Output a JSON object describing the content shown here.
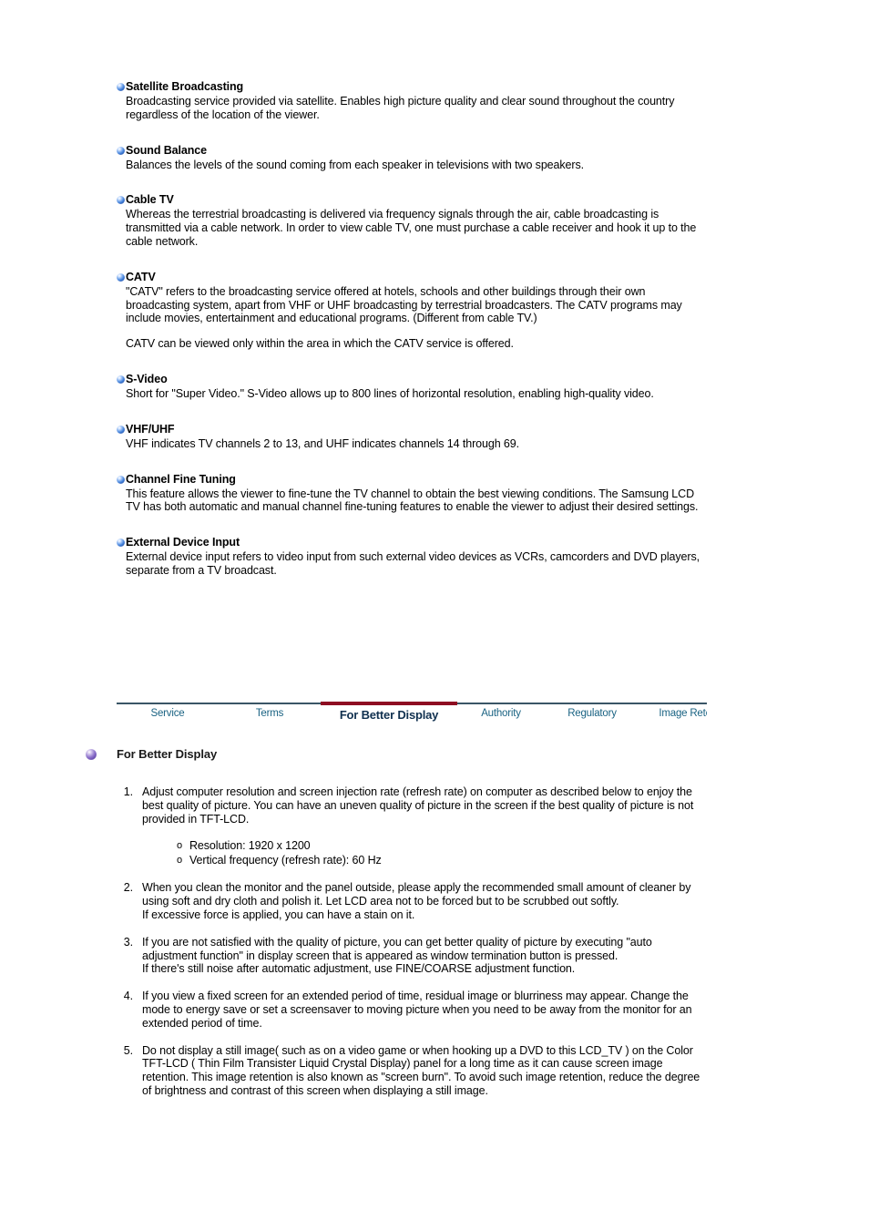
{
  "glossary": {
    "terms": [
      {
        "title": "Satellite Broadcasting",
        "paragraphs": [
          "Broadcasting service provided via satellite. Enables high picture quality and clear sound throughout the country regardless of the location of the viewer."
        ]
      },
      {
        "title": "Sound Balance",
        "paragraphs": [
          "Balances the levels of the sound coming from each speaker in televisions with two speakers."
        ]
      },
      {
        "title": "Cable TV",
        "paragraphs": [
          "Whereas the terrestrial broadcasting is delivered via frequency signals through the air, cable broadcasting is transmitted via a cable network. In order to view cable TV, one must purchase a cable receiver and hook it up to the cable network."
        ]
      },
      {
        "title": "CATV",
        "paragraphs": [
          "\"CATV\" refers to the broadcasting service offered at hotels, schools and other buildings through their own broadcasting system, apart from VHF or UHF broadcasting by terrestrial broadcasters. The CATV programs may include movies, entertainment and educational programs. (Different from cable TV.)",
          "CATV can be viewed only within the area in which the CATV service is offered."
        ]
      },
      {
        "title": "S-Video",
        "paragraphs": [
          "Short for \"Super Video.\" S-Video allows up to 800 lines of horizontal resolution, enabling high-quality video."
        ]
      },
      {
        "title": "VHF/UHF",
        "paragraphs": [
          "VHF indicates TV channels 2 to 13, and UHF indicates channels 14 through 69."
        ]
      },
      {
        "title": "Channel Fine Tuning",
        "paragraphs": [
          "This feature allows the viewer to fine-tune the TV channel to obtain the best viewing conditions. The Samsung LCD TV has both automatic and manual channel fine-tuning features to enable the viewer to adjust their desired settings."
        ]
      },
      {
        "title": "External Device Input",
        "paragraphs": [
          "External device input refers to video input from such external video devices as VCRs, camcorders and DVD players, separate from a TV broadcast."
        ]
      }
    ]
  },
  "tabnav": {
    "tabs": [
      {
        "label": "Service",
        "active": false
      },
      {
        "label": "Terms",
        "active": false
      },
      {
        "label": "For Better Display",
        "active": true
      },
      {
        "label": "Authority",
        "active": false
      },
      {
        "label": "Regulatory",
        "active": false
      },
      {
        "label": "Image Retention Free",
        "active": false
      }
    ],
    "active_indicator_color": "#8e0c22",
    "rule_color": "#3a5566",
    "link_color": "#1a6383"
  },
  "section": {
    "title": "For Better Display",
    "bullet_color": "#5b3da5",
    "items": [
      {
        "number": "1.",
        "paragraphs": [
          "Adjust computer resolution and screen injection rate (refresh rate) on computer as described below to enjoy the best quality of picture. You can have an uneven quality of picture in the screen if the best quality of picture is not provided in TFT-LCD."
        ],
        "sublist": [
          "Resolution: 1920 x 1200",
          "Vertical frequency (refresh rate): 60 Hz"
        ]
      },
      {
        "number": "2.",
        "paragraphs": [
          "When you clean the monitor and the panel outside, please apply the recommended small amount of cleaner by using soft and dry cloth and polish it. Let LCD area not to be forced but to be scrubbed out softly.",
          "If excessive force is applied, you can have a stain on it."
        ],
        "sublist": []
      },
      {
        "number": "3.",
        "paragraphs": [
          "If you are not satisfied with the quality of picture, you can get better quality of picture by executing \"auto adjustment function\" in display screen that is appeared as window termination button is pressed.",
          "If there's still noise after automatic adjustment, use FINE/COARSE adjustment function."
        ],
        "sublist": []
      },
      {
        "number": "4.",
        "paragraphs": [
          "If you view a fixed screen for an extended period of time, residual image or blurriness may appear. Change the mode to energy save or set a screensaver to moving picture when you need to be away from the monitor for an extended period of time."
        ],
        "sublist": []
      },
      {
        "number": "5.",
        "paragraphs": [
          "Do not display a still image( such as on a video game or when hooking up a DVD to this LCD_TV ) on the Color TFT-LCD ( Thin Film Transister Liquid Crystal Display) panel for a long time as it can cause screen image retention. This image retention is also known as \"screen burn\". To avoid such image retention, reduce the degree of brightness and contrast of this screen when displaying a still image."
        ],
        "sublist": []
      }
    ]
  }
}
